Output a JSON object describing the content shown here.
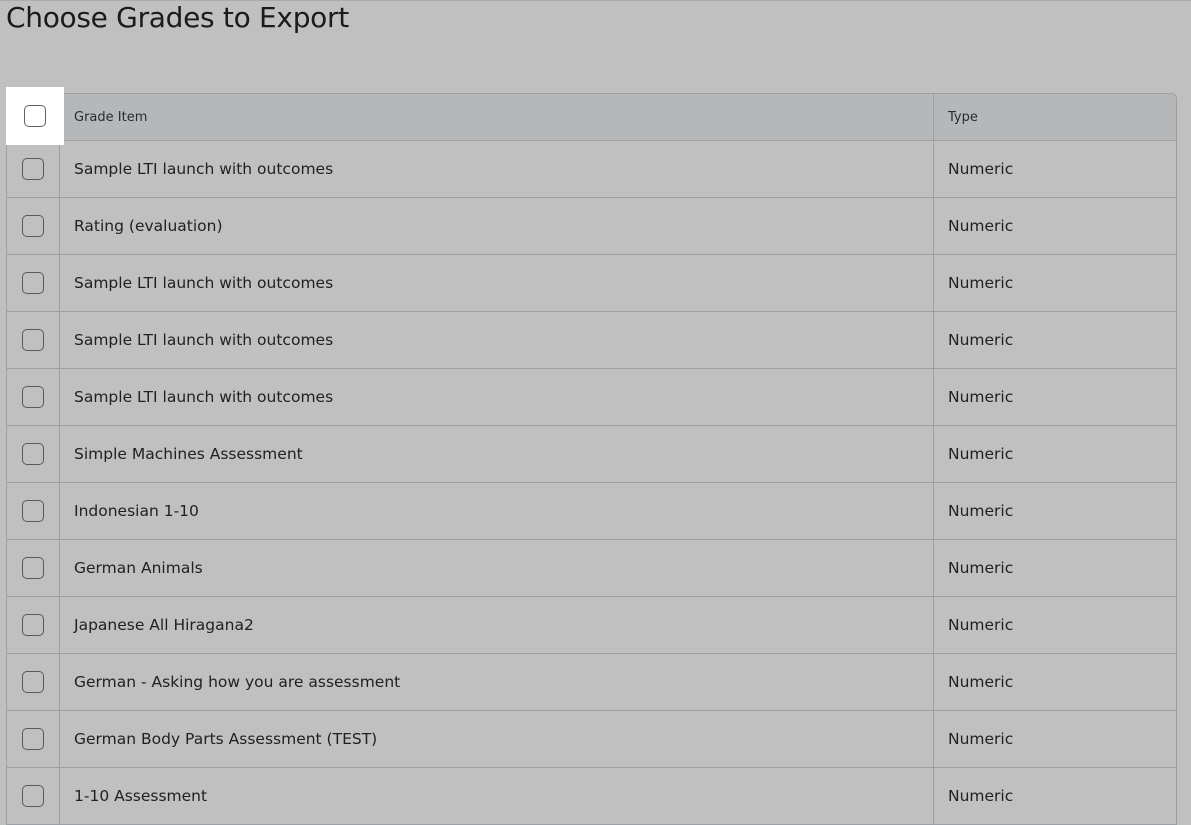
{
  "page": {
    "title": "Choose Grades to Export"
  },
  "table": {
    "headers": {
      "grade_item": "Grade Item",
      "type": "Type"
    },
    "rows": [
      {
        "item": "Sample LTI launch with outcomes",
        "type": "Numeric"
      },
      {
        "item": "Rating (evaluation)",
        "type": "Numeric"
      },
      {
        "item": "Sample LTI launch with outcomes",
        "type": "Numeric"
      },
      {
        "item": "Sample LTI launch with outcomes",
        "type": "Numeric"
      },
      {
        "item": "Sample LTI launch with outcomes",
        "type": "Numeric"
      },
      {
        "item": "Simple Machines Assessment",
        "type": "Numeric"
      },
      {
        "item": "Indonesian 1-10",
        "type": "Numeric"
      },
      {
        "item": "German Animals",
        "type": "Numeric"
      },
      {
        "item": "Japanese All Hiragana2",
        "type": "Numeric"
      },
      {
        "item": "German - Asking how you are assessment",
        "type": "Numeric"
      },
      {
        "item": "German Body Parts Assessment (TEST)",
        "type": "Numeric"
      },
      {
        "item": "1-10 Assessment",
        "type": "Numeric"
      }
    ]
  }
}
